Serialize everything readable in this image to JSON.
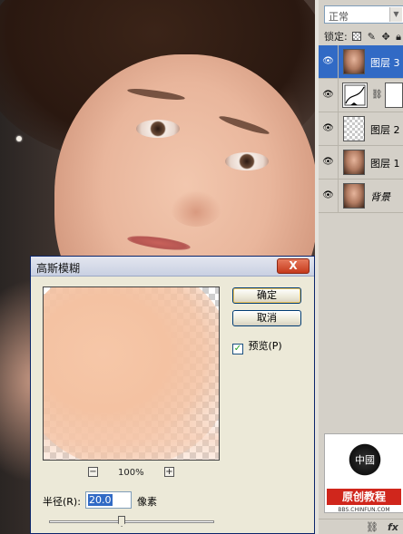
{
  "canvas": {
    "image_description_icon": "portrait-photo"
  },
  "layers_panel": {
    "blend_mode": "正常",
    "lock_label": "锁定:",
    "lock_icons": [
      "lock-transparency-icon",
      "lock-paint-icon",
      "lock-move-icon",
      "lock-all-icon"
    ],
    "layers": [
      {
        "name": "图层 3",
        "thumb": "face",
        "selected": true
      },
      {
        "name": "",
        "thumb": "curves",
        "selected": false,
        "mask": true
      },
      {
        "name": "图层 2",
        "thumb": "checker",
        "selected": false
      },
      {
        "name": "图层 1",
        "thumb": "face",
        "selected": false
      },
      {
        "name": "背景",
        "thumb": "face",
        "selected": false,
        "italic": true
      }
    ],
    "footer_icons": [
      "link-icon",
      "fx-icon"
    ],
    "logo": {
      "seal_text": "中國",
      "banner": "原创教程",
      "url": "BBS.CHINFUN.COM"
    }
  },
  "dialog": {
    "title": "高斯模糊",
    "close": "X",
    "ok_label": "确定",
    "cancel_label": "取消",
    "preview_label": "预览(P)",
    "preview_checked": true,
    "zoom_out": "−",
    "zoom_in": "+",
    "zoom_level": "100%",
    "radius_label": "半径(R):",
    "radius_value": "20.0",
    "radius_unit": "像素",
    "slider_fraction": 0.44
  },
  "colors": {
    "selection": "#316ac5",
    "dialog_bg": "#ece9d8",
    "close_red": "#c53a1c"
  }
}
